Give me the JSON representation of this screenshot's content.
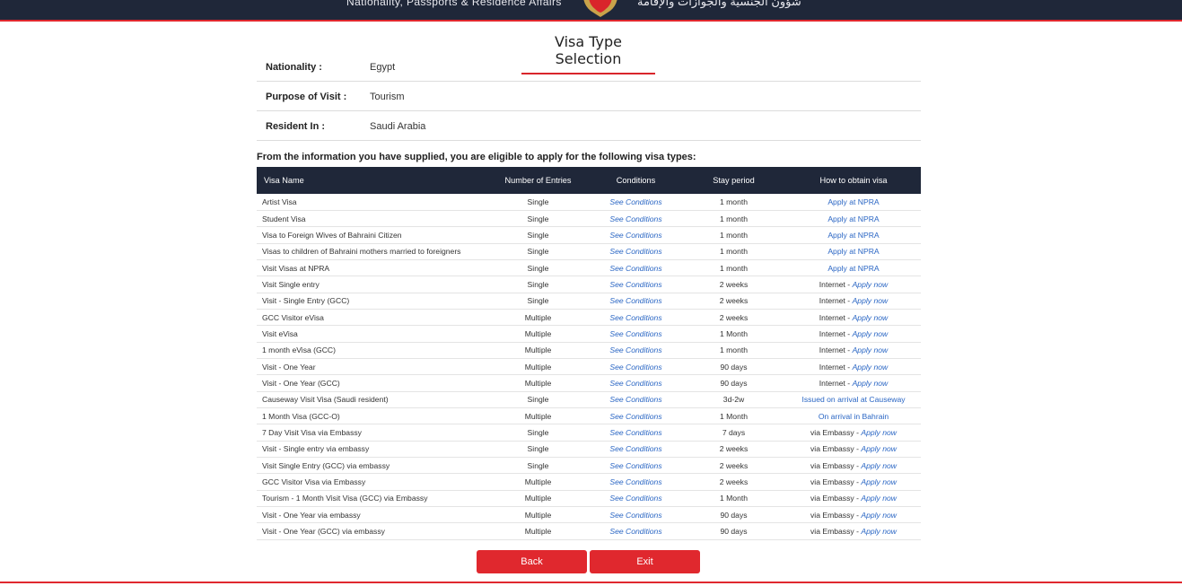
{
  "header": {
    "title_en": "Nationality, Passports & Residence Affairs",
    "title_ar": "شؤون الجنسية والجوازات والإقامة",
    "emblem_icon": "bahrain-emblem-icon"
  },
  "page": {
    "title": "Visa Type Selection"
  },
  "info": [
    {
      "label": "Nationality :",
      "value": "Egypt"
    },
    {
      "label": "Purpose of Visit :",
      "value": "Tourism"
    },
    {
      "label": "Resident In :",
      "value": "Saudi Arabia"
    }
  ],
  "eligible_text": "From the information you have supplied, you are eligible to apply for the following visa types:",
  "table": {
    "headers": [
      "Visa Name",
      "Number of Entries",
      "Conditions",
      "Stay period",
      "How to obtain visa"
    ],
    "rows": [
      {
        "name": "Artist Visa",
        "entries": "Single",
        "conditions": "See Conditions",
        "stay": "1 month",
        "obtain_prefix": "",
        "obtain_link": "Apply at NPRA"
      },
      {
        "name": "Student Visa",
        "entries": "Single",
        "conditions": "See Conditions",
        "stay": "1 month",
        "obtain_prefix": "",
        "obtain_link": "Apply at NPRA"
      },
      {
        "name": "Visa to Foreign Wives of Bahraini Citizen",
        "entries": "Single",
        "conditions": "See Conditions",
        "stay": "1 month",
        "obtain_prefix": "",
        "obtain_link": "Apply at NPRA"
      },
      {
        "name": "Visas to children of Bahraini mothers married to foreigners",
        "entries": "Single",
        "conditions": "See Conditions",
        "stay": "1 month",
        "obtain_prefix": "",
        "obtain_link": "Apply at NPRA"
      },
      {
        "name": "Visit Visas at NPRA",
        "entries": "Single",
        "conditions": "See Conditions",
        "stay": "1 month",
        "obtain_prefix": "",
        "obtain_link": "Apply at NPRA"
      },
      {
        "name": "Visit Single entry",
        "entries": "Single",
        "conditions": "See Conditions",
        "stay": "2 weeks",
        "obtain_prefix": "Internet - ",
        "obtain_link": "Apply now"
      },
      {
        "name": "Visit - Single Entry (GCC)",
        "entries": "Single",
        "conditions": "See Conditions",
        "stay": "2 weeks",
        "obtain_prefix": "Internet - ",
        "obtain_link": "Apply now"
      },
      {
        "name": "GCC Visitor eVisa",
        "entries": "Multiple",
        "conditions": "See Conditions",
        "stay": "2 weeks",
        "obtain_prefix": "Internet - ",
        "obtain_link": "Apply now"
      },
      {
        "name": "Visit eVisa",
        "entries": "Multiple",
        "conditions": "See Conditions",
        "stay": "1 Month",
        "obtain_prefix": "Internet - ",
        "obtain_link": "Apply now"
      },
      {
        "name": "1 month eVisa (GCC)",
        "entries": "Multiple",
        "conditions": "See Conditions",
        "stay": "1 month",
        "obtain_prefix": "Internet - ",
        "obtain_link": "Apply now"
      },
      {
        "name": "Visit - One Year",
        "entries": "Multiple",
        "conditions": "See Conditions",
        "stay": "90 days",
        "obtain_prefix": "Internet - ",
        "obtain_link": "Apply now"
      },
      {
        "name": "Visit - One Year (GCC)",
        "entries": "Multiple",
        "conditions": "See Conditions",
        "stay": "90 days",
        "obtain_prefix": "Internet - ",
        "obtain_link": "Apply now"
      },
      {
        "name": "Causeway Visit Visa (Saudi resident)",
        "entries": "Single",
        "conditions": "See Conditions",
        "stay": "3d-2w",
        "obtain_prefix": "",
        "obtain_link": "Issued on arrival at Causeway"
      },
      {
        "name": "1 Month Visa (GCC-O)",
        "entries": "Multiple",
        "conditions": "See Conditions",
        "stay": "1 Month",
        "obtain_prefix": "",
        "obtain_link": "On arrival in Bahrain"
      },
      {
        "name": "7 Day Visit Visa via Embassy",
        "entries": "Single",
        "conditions": "See Conditions",
        "stay": "7 days",
        "obtain_prefix": "via Embassy - ",
        "obtain_link": "Apply now"
      },
      {
        "name": "Visit - Single entry via embassy",
        "entries": "Single",
        "conditions": "See Conditions",
        "stay": "2 weeks",
        "obtain_prefix": "via Embassy - ",
        "obtain_link": "Apply now"
      },
      {
        "name": "Visit Single Entry (GCC) via embassy",
        "entries": "Single",
        "conditions": "See Conditions",
        "stay": "2 weeks",
        "obtain_prefix": "via Embassy - ",
        "obtain_link": "Apply now"
      },
      {
        "name": "GCC Visitor Visa via Embassy",
        "entries": "Multiple",
        "conditions": "See Conditions",
        "stay": "2 weeks",
        "obtain_prefix": "via Embassy - ",
        "obtain_link": "Apply now"
      },
      {
        "name": "Tourism - 1 Month Visit Visa (GCC) via Embassy",
        "entries": "Multiple",
        "conditions": "See Conditions",
        "stay": "1 Month",
        "obtain_prefix": "via Embassy - ",
        "obtain_link": "Apply now"
      },
      {
        "name": "Visit - One Year via embassy",
        "entries": "Multiple",
        "conditions": "See Conditions",
        "stay": "90 days",
        "obtain_prefix": "via Embassy - ",
        "obtain_link": "Apply now"
      },
      {
        "name": "Visit - One Year (GCC) via embassy",
        "entries": "Multiple",
        "conditions": "See Conditions",
        "stay": "90 days",
        "obtain_prefix": "via Embassy - ",
        "obtain_link": "Apply now"
      }
    ]
  },
  "buttons": {
    "back": "Back",
    "exit": "Exit"
  },
  "colors": {
    "header_bg": "#1f2739",
    "accent_red": "#e0282e",
    "link_blue": "#2a66c4"
  }
}
